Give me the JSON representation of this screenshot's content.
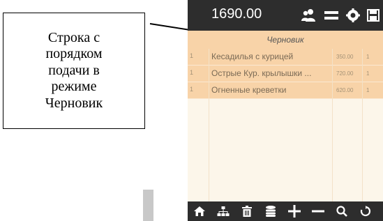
{
  "callout": {
    "text": "Строка с\nпорядком\nподачи в\nрежиме\nЧерновик"
  },
  "app": {
    "total": "1690.00",
    "status": "Черновик",
    "top_icons": [
      "users-icon",
      "menu-icon",
      "settings-icon",
      "save-icon"
    ],
    "bottom_icons": [
      "home-icon",
      "sitemap-icon",
      "trash-icon",
      "database-icon",
      "plus-icon",
      "minus-icon",
      "search-icon",
      "refresh-icon"
    ]
  },
  "order": {
    "items": [
      {
        "num": "1",
        "name": "Кесадилья с курицей",
        "price": "350.00",
        "qty": "1"
      },
      {
        "num": "1",
        "name": "Острые Кур. крылышки ...",
        "price": "720.00",
        "qty": "1"
      },
      {
        "num": "1",
        "name": "Огненные креветки",
        "price": "620.00",
        "qty": "1"
      }
    ]
  },
  "colors": {
    "toolbar": "#2d2d2d",
    "row_bg": "#f8d3a8",
    "panel_bg": "#fcf6ea",
    "text": "#7a6a55"
  }
}
